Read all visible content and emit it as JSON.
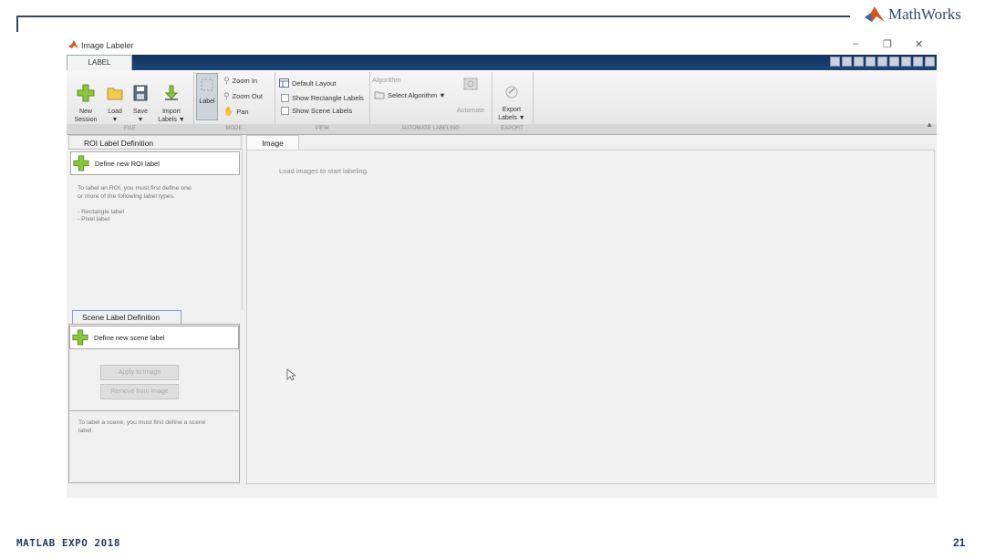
{
  "slide": {
    "brand": "MathWorks",
    "brand_mark": "®",
    "footer": "MATLAB EXPO 2018",
    "page_number": "21"
  },
  "window": {
    "title": "Image Labeler",
    "controls": {
      "minimize": "–",
      "restore": "❐",
      "close": "✕"
    },
    "tab": "LABEL"
  },
  "ribbon": {
    "file": {
      "new_session": "New\nSession",
      "load": "Load\n▼",
      "save": "Save\n▼",
      "import_labels": "Import\nLabels ▼",
      "section": "FILE"
    },
    "mode": {
      "label": "Label",
      "zoom_in": "Zoom In",
      "zoom_out": "Zoom Out",
      "pan": "Pan",
      "section": "MODE"
    },
    "view": {
      "default_layout": "Default Layout",
      "show_rectangle_labels": "Show Rectangle Labels",
      "show_scene_labels": "Show Scene Labels",
      "section": "VIEW"
    },
    "automate": {
      "algorithm": "Algorithm",
      "select_algorithm": "Select Algorithm ▼",
      "automate": "Automate",
      "section": "AUTOMATE LABELING"
    },
    "export": {
      "export_labels": "Export\nLabels ▼",
      "section": "EXPORT"
    }
  },
  "roi_panel": {
    "title": "ROI Label Definition",
    "define": "Define new ROI label",
    "help": "To label an ROI, you must first define one\nor more of the following label types.\n\n- Rectangle label\n- Pixel label"
  },
  "scene_panel": {
    "title": "Scene Label Definition",
    "define": "Define new scene label",
    "apply": "Apply to Image",
    "remove": "Remove from Image",
    "help": "To label a scene, you must first define a scene\nlabel."
  },
  "image_panel": {
    "tab": "Image",
    "message": "Load images to start labeling."
  },
  "colors": {
    "tabstrip": "#1b467a",
    "add_icon": "#8cc63f",
    "brand": "#2c4a72"
  }
}
